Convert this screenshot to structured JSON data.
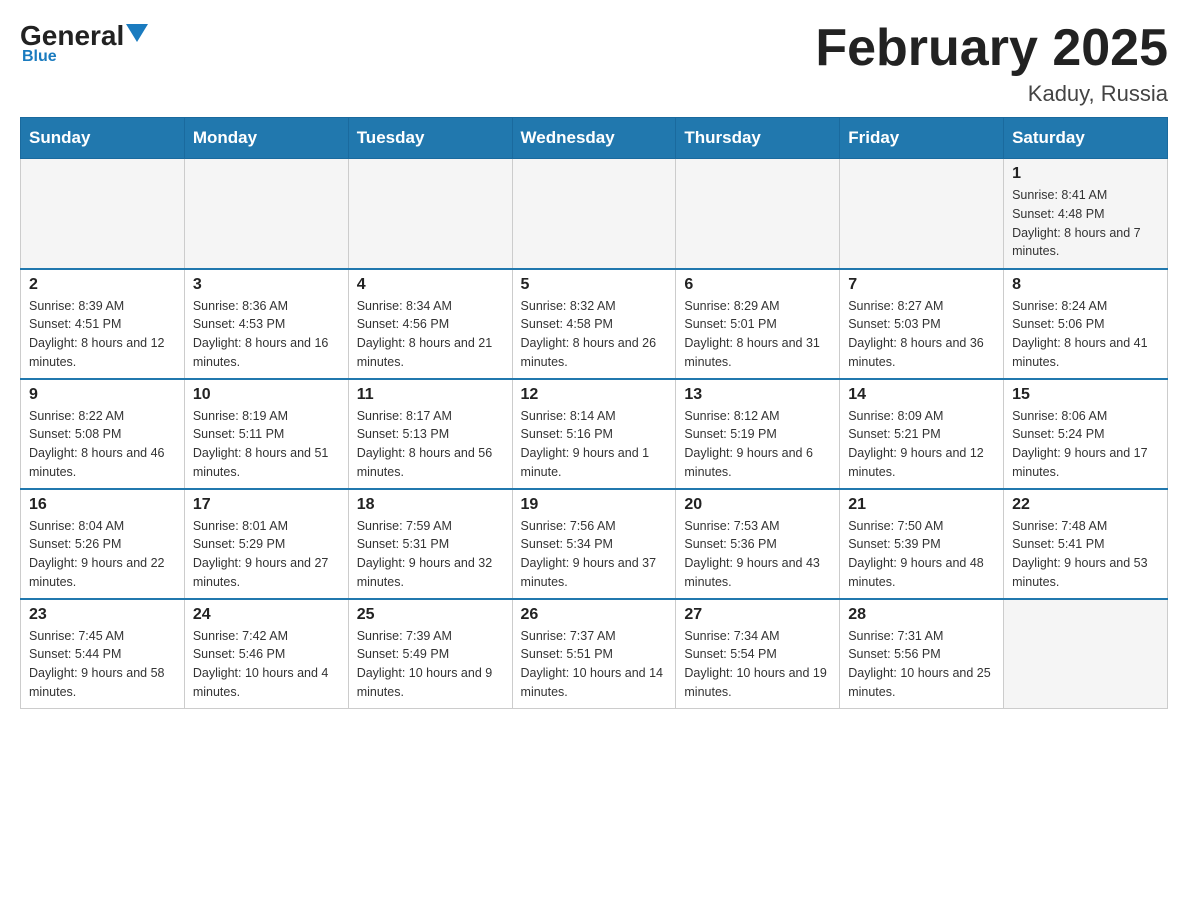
{
  "header": {
    "logo": {
      "general": "General",
      "triangle": "▼",
      "blue": "Blue"
    },
    "title": "February 2025",
    "location": "Kaduy, Russia"
  },
  "days_of_week": [
    "Sunday",
    "Monday",
    "Tuesday",
    "Wednesday",
    "Thursday",
    "Friday",
    "Saturday"
  ],
  "weeks": [
    [
      {
        "day": "",
        "info": ""
      },
      {
        "day": "",
        "info": ""
      },
      {
        "day": "",
        "info": ""
      },
      {
        "day": "",
        "info": ""
      },
      {
        "day": "",
        "info": ""
      },
      {
        "day": "",
        "info": ""
      },
      {
        "day": "1",
        "info": "Sunrise: 8:41 AM\nSunset: 4:48 PM\nDaylight: 8 hours and 7 minutes."
      }
    ],
    [
      {
        "day": "2",
        "info": "Sunrise: 8:39 AM\nSunset: 4:51 PM\nDaylight: 8 hours and 12 minutes."
      },
      {
        "day": "3",
        "info": "Sunrise: 8:36 AM\nSunset: 4:53 PM\nDaylight: 8 hours and 16 minutes."
      },
      {
        "day": "4",
        "info": "Sunrise: 8:34 AM\nSunset: 4:56 PM\nDaylight: 8 hours and 21 minutes."
      },
      {
        "day": "5",
        "info": "Sunrise: 8:32 AM\nSunset: 4:58 PM\nDaylight: 8 hours and 26 minutes."
      },
      {
        "day": "6",
        "info": "Sunrise: 8:29 AM\nSunset: 5:01 PM\nDaylight: 8 hours and 31 minutes."
      },
      {
        "day": "7",
        "info": "Sunrise: 8:27 AM\nSunset: 5:03 PM\nDaylight: 8 hours and 36 minutes."
      },
      {
        "day": "8",
        "info": "Sunrise: 8:24 AM\nSunset: 5:06 PM\nDaylight: 8 hours and 41 minutes."
      }
    ],
    [
      {
        "day": "9",
        "info": "Sunrise: 8:22 AM\nSunset: 5:08 PM\nDaylight: 8 hours and 46 minutes."
      },
      {
        "day": "10",
        "info": "Sunrise: 8:19 AM\nSunset: 5:11 PM\nDaylight: 8 hours and 51 minutes."
      },
      {
        "day": "11",
        "info": "Sunrise: 8:17 AM\nSunset: 5:13 PM\nDaylight: 8 hours and 56 minutes."
      },
      {
        "day": "12",
        "info": "Sunrise: 8:14 AM\nSunset: 5:16 PM\nDaylight: 9 hours and 1 minute."
      },
      {
        "day": "13",
        "info": "Sunrise: 8:12 AM\nSunset: 5:19 PM\nDaylight: 9 hours and 6 minutes."
      },
      {
        "day": "14",
        "info": "Sunrise: 8:09 AM\nSunset: 5:21 PM\nDaylight: 9 hours and 12 minutes."
      },
      {
        "day": "15",
        "info": "Sunrise: 8:06 AM\nSunset: 5:24 PM\nDaylight: 9 hours and 17 minutes."
      }
    ],
    [
      {
        "day": "16",
        "info": "Sunrise: 8:04 AM\nSunset: 5:26 PM\nDaylight: 9 hours and 22 minutes."
      },
      {
        "day": "17",
        "info": "Sunrise: 8:01 AM\nSunset: 5:29 PM\nDaylight: 9 hours and 27 minutes."
      },
      {
        "day": "18",
        "info": "Sunrise: 7:59 AM\nSunset: 5:31 PM\nDaylight: 9 hours and 32 minutes."
      },
      {
        "day": "19",
        "info": "Sunrise: 7:56 AM\nSunset: 5:34 PM\nDaylight: 9 hours and 37 minutes."
      },
      {
        "day": "20",
        "info": "Sunrise: 7:53 AM\nSunset: 5:36 PM\nDaylight: 9 hours and 43 minutes."
      },
      {
        "day": "21",
        "info": "Sunrise: 7:50 AM\nSunset: 5:39 PM\nDaylight: 9 hours and 48 minutes."
      },
      {
        "day": "22",
        "info": "Sunrise: 7:48 AM\nSunset: 5:41 PM\nDaylight: 9 hours and 53 minutes."
      }
    ],
    [
      {
        "day": "23",
        "info": "Sunrise: 7:45 AM\nSunset: 5:44 PM\nDaylight: 9 hours and 58 minutes."
      },
      {
        "day": "24",
        "info": "Sunrise: 7:42 AM\nSunset: 5:46 PM\nDaylight: 10 hours and 4 minutes."
      },
      {
        "day": "25",
        "info": "Sunrise: 7:39 AM\nSunset: 5:49 PM\nDaylight: 10 hours and 9 minutes."
      },
      {
        "day": "26",
        "info": "Sunrise: 7:37 AM\nSunset: 5:51 PM\nDaylight: 10 hours and 14 minutes."
      },
      {
        "day": "27",
        "info": "Sunrise: 7:34 AM\nSunset: 5:54 PM\nDaylight: 10 hours and 19 minutes."
      },
      {
        "day": "28",
        "info": "Sunrise: 7:31 AM\nSunset: 5:56 PM\nDaylight: 10 hours and 25 minutes."
      },
      {
        "day": "",
        "info": ""
      }
    ]
  ]
}
